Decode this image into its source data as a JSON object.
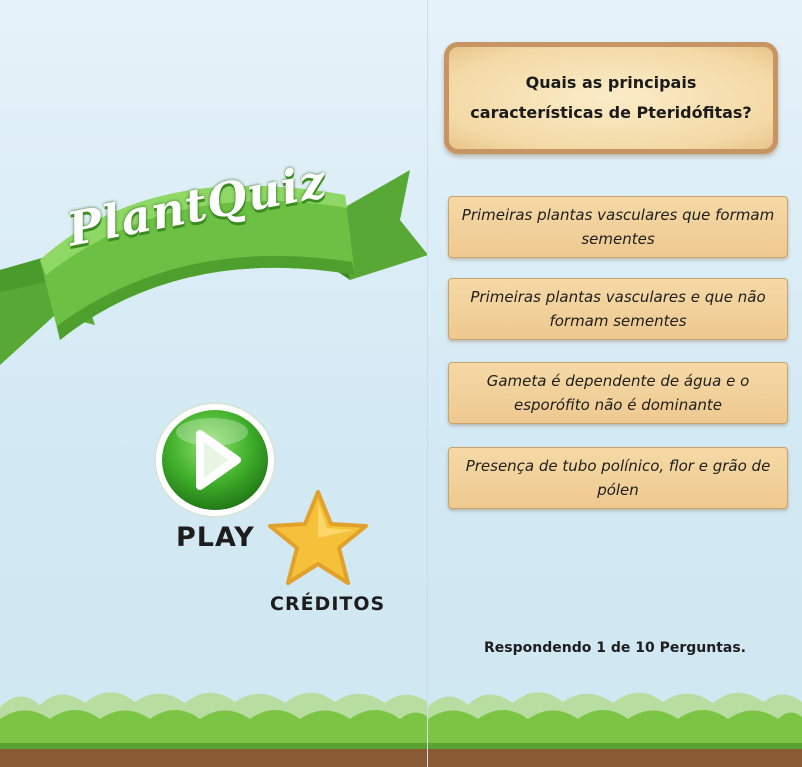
{
  "menu": {
    "logo_title": "PlantQuiz",
    "play_label": "PLAY",
    "credits_label": "CRÉDITOS",
    "play_icon": "play-triangle-icon",
    "credits_icon": "star-icon"
  },
  "quiz": {
    "question": "Quais as principais características de Pteridófitas?",
    "answers": [
      {
        "label": "Primeiras plantas vasculares que formam sementes"
      },
      {
        "label": "Primeiras plantas vasculares e que não formam sementes"
      },
      {
        "label": "Gameta é dependente de água e o esporófito não é dominante"
      },
      {
        "label": "Presença de tubo polínico, flor e grão de pólen"
      }
    ],
    "progress": "Respondendo 1 de 10 Perguntas."
  },
  "colors": {
    "banner_green": "#6cc043",
    "play_green": "#3fae2a",
    "star_yellow": "#f6c13a",
    "card_tan": "#f1d29e",
    "grass_green": "#7bc444",
    "soil_brown": "#8a5a34"
  }
}
